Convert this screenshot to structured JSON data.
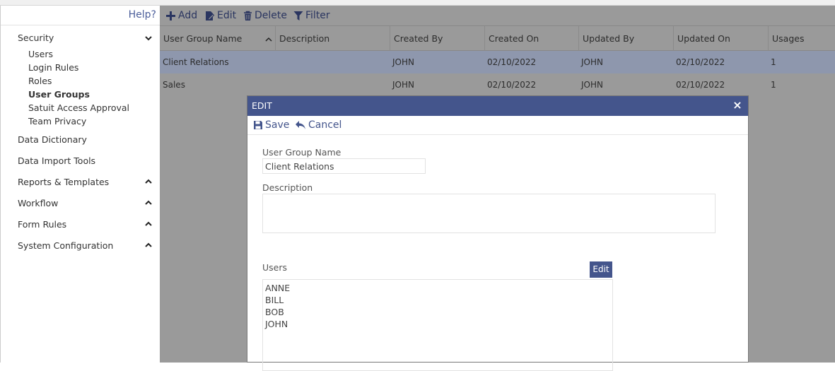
{
  "sidebar": {
    "help_label": "Help?",
    "sections": [
      {
        "label": "Security",
        "chevron": "chevron-down-icon"
      },
      {
        "label": "Data Dictionary"
      },
      {
        "label": "Data Import Tools"
      },
      {
        "label": "Reports & Templates",
        "chevron": "chevron-up-icon"
      },
      {
        "label": "Workflow",
        "chevron": "chevron-up-icon"
      },
      {
        "label": "Form Rules",
        "chevron": "chevron-up-icon"
      },
      {
        "label": "System Configuration",
        "chevron": "chevron-up-icon"
      }
    ],
    "security_items": [
      {
        "label": "Users"
      },
      {
        "label": "Login Rules"
      },
      {
        "label": "Roles"
      },
      {
        "label": "User Groups",
        "active": true
      },
      {
        "label": "Satuit Access Approval"
      },
      {
        "label": "Team Privacy"
      }
    ]
  },
  "toolbar": {
    "add_label": "Add",
    "edit_label": "Edit",
    "delete_label": "Delete",
    "filter_label": "Filter"
  },
  "grid": {
    "columns": [
      "User Group Name",
      "Description",
      "Created By",
      "Created On",
      "Updated By",
      "Updated On",
      "Usages"
    ],
    "rows": [
      {
        "name": "Client Relations",
        "description": "",
        "created_by": "JOHN",
        "created_on": "02/10/2022",
        "updated_by": "JOHN",
        "updated_on": "02/10/2022",
        "usages": "1",
        "selected": true
      },
      {
        "name": "Sales",
        "description": "",
        "created_by": "JOHN",
        "created_on": "02/10/2022",
        "updated_by": "JOHN",
        "updated_on": "02/10/2022",
        "usages": "1",
        "selected": false
      }
    ]
  },
  "modal": {
    "title": "EDIT",
    "close": "×",
    "save_label": "Save",
    "cancel_label": "Cancel",
    "group_name_label": "User Group Name",
    "group_name_value": "Client Relations",
    "description_label": "Description",
    "description_value": "",
    "users_label": "Users",
    "users_edit_label": "Edit",
    "users": [
      "ANNE",
      "BILL",
      "BOB",
      "JOHN"
    ]
  },
  "colors": {
    "accent": "#44558c",
    "overlay": "#9a9a9a",
    "selected_row": "#8e97ad"
  }
}
